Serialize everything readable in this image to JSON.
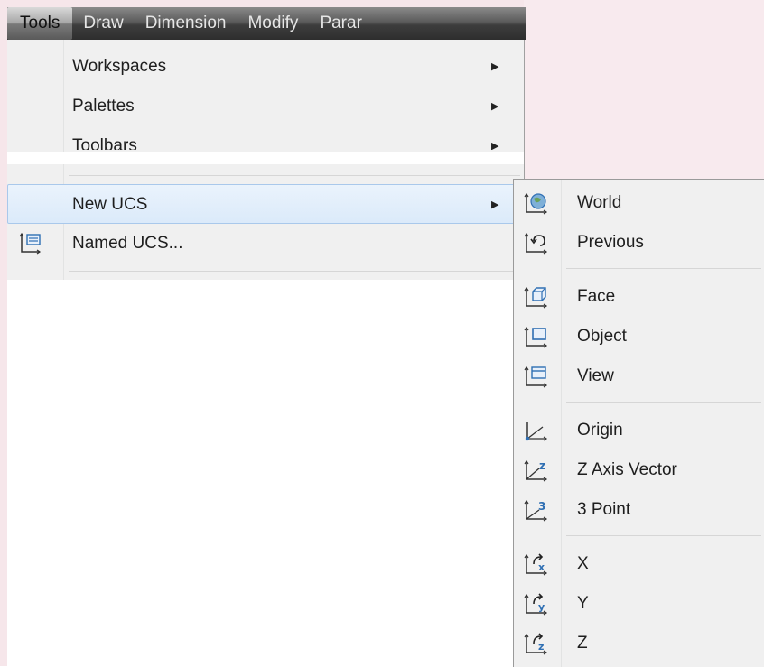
{
  "menubar": {
    "items": [
      "Tools",
      "Draw",
      "Dimension",
      "Modify",
      "Parar"
    ]
  },
  "tools_menu": {
    "items": [
      {
        "label": "Workspaces",
        "has_submenu": true
      },
      {
        "label": "Palettes",
        "has_submenu": true
      },
      {
        "label": "Toolbars",
        "has_submenu": true
      },
      {
        "label": "New UCS",
        "has_submenu": true,
        "highlighted": true
      },
      {
        "label": "Named UCS...",
        "icon": "named-ucs-icon"
      }
    ]
  },
  "new_ucs_submenu": {
    "items": [
      {
        "label": "World",
        "icon": "ucs-world-icon"
      },
      {
        "label": "Previous",
        "icon": "ucs-previous-icon"
      },
      {
        "label": "Face",
        "icon": "ucs-face-icon"
      },
      {
        "label": "Object",
        "icon": "ucs-object-icon"
      },
      {
        "label": "View",
        "icon": "ucs-view-icon"
      },
      {
        "label": "Origin",
        "icon": "ucs-origin-icon"
      },
      {
        "label": "Z Axis Vector",
        "icon": "ucs-z-axis-vector-icon"
      },
      {
        "label": "3 Point",
        "icon": "ucs-3-point-icon"
      },
      {
        "label": "X",
        "icon": "ucs-rotate-x-icon"
      },
      {
        "label": "Y",
        "icon": "ucs-rotate-y-icon"
      },
      {
        "label": "Z",
        "icon": "ucs-rotate-z-icon"
      }
    ]
  },
  "colors": {
    "highlight_fill": "#dbeafa",
    "highlight_border": "#a9c8eb",
    "menubar_dark": "#2e2e2e",
    "icon_blue": "#2f6fb3"
  }
}
